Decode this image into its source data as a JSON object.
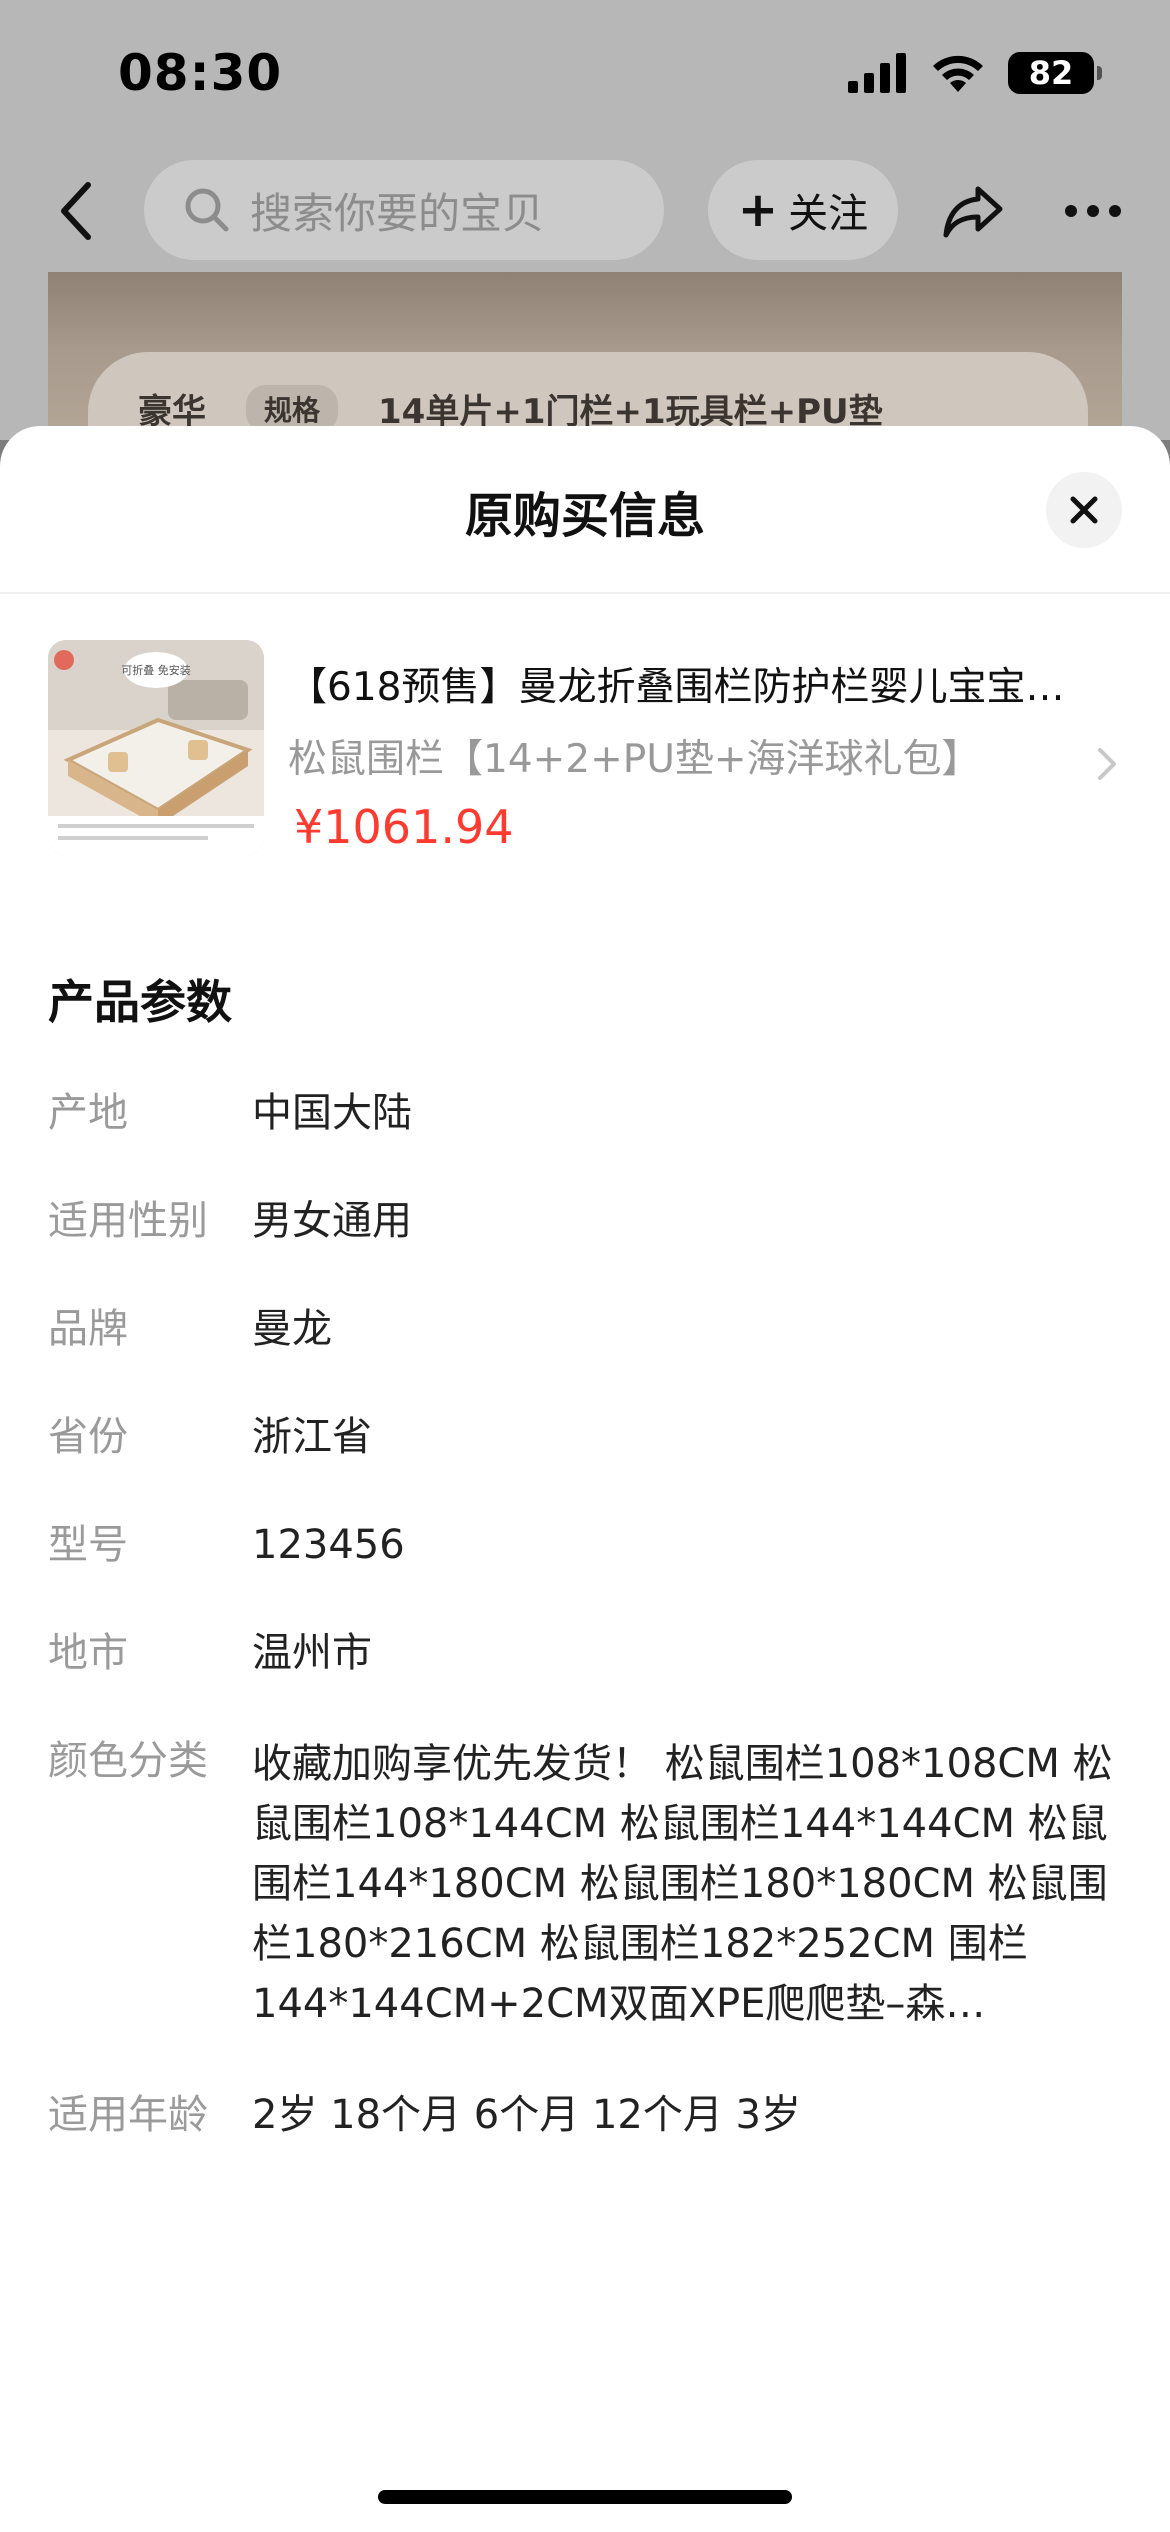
{
  "status_bar": {
    "time": "08:30",
    "battery": "82"
  },
  "nav": {
    "search_placeholder": "搜索你要的宝贝",
    "follow_label": "关注"
  },
  "background_banner": {
    "left_text": "豪华",
    "tag": "规格",
    "spec_text": "14单片+1门栏+1玩具栏+PU垫"
  },
  "sheet": {
    "title": "原购买信息",
    "product": {
      "thumb_badge": "可折叠 免安装",
      "title": "【618预售】曼龙折叠围栏防护栏婴儿宝宝…",
      "spec": "松鼠围栏【14+2+PU垫+海洋球礼包】",
      "price": "¥1061.94"
    },
    "params_title": "产品参数",
    "params": [
      {
        "label": "产地",
        "value": "中国大陆"
      },
      {
        "label": "适用性别",
        "value": "男女通用"
      },
      {
        "label": "品牌",
        "value": "曼龙"
      },
      {
        "label": "省份",
        "value": "浙江省"
      },
      {
        "label": "型号",
        "value": "123456"
      },
      {
        "label": "地市",
        "value": "温州市"
      },
      {
        "label": "颜色分类",
        "value": "收藏加购享优先发货！ 松鼠围栏108*108CM 松鼠围栏108*144CM 松鼠围栏144*144CM 松鼠围栏144*180CM 松鼠围栏180*180CM 松鼠围栏180*216CM 松鼠围栏182*252CM 围栏144*144CM+2CM双面XPE爬爬垫–森…"
      },
      {
        "label": "适用年龄",
        "value": "2岁 18个月 6个月 12个月 3岁"
      }
    ]
  },
  "colors": {
    "price": "#ff3b30",
    "label_gray": "#9a9a9a",
    "overlay": "#7d7d7d"
  }
}
